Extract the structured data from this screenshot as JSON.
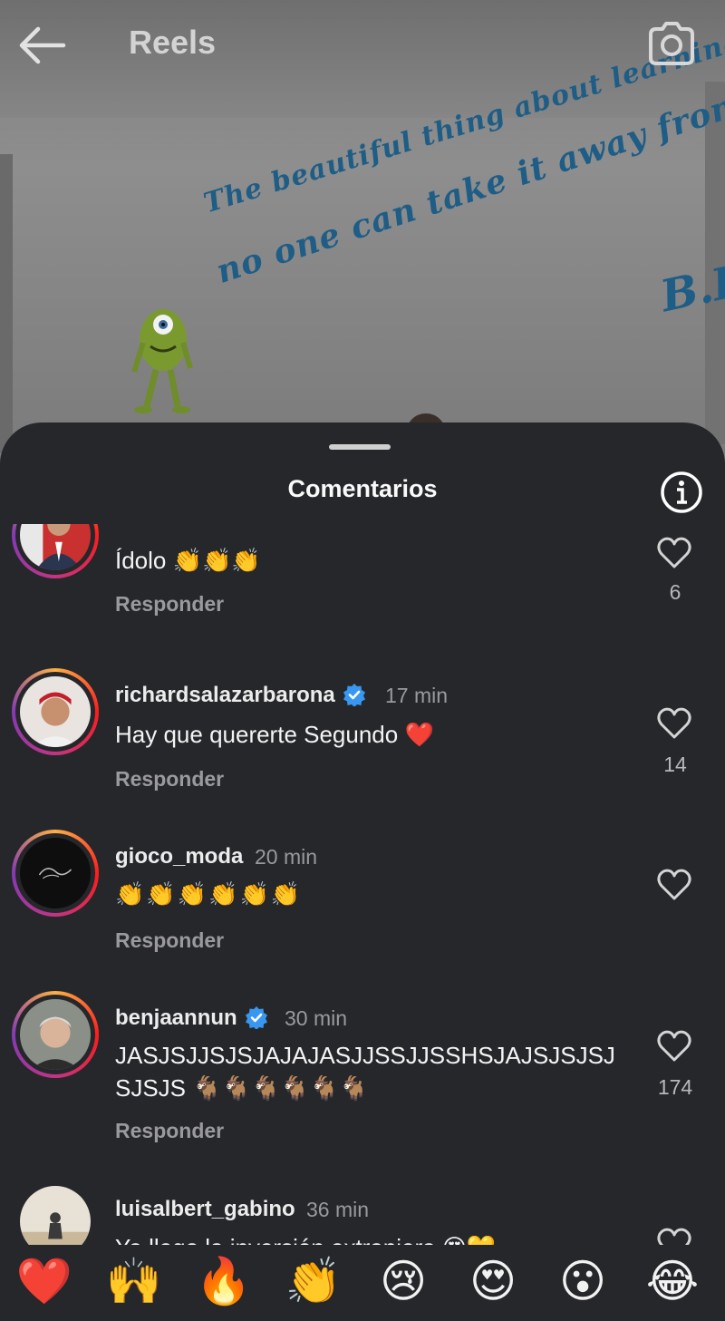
{
  "header": {
    "title": "Reels",
    "back_icon": "arrow-left-icon",
    "camera_icon": "camera-icon"
  },
  "video": {
    "quote_lines": [
      "The beautiful thing about learning i",
      "no one can take it away from yo",
      "B.B"
    ]
  },
  "sheet": {
    "title": "Comentarios",
    "info_icon": "info-icon"
  },
  "comments": [
    {
      "username": "",
      "verified": true,
      "time": "",
      "text": "Ídolo 👏👏👏",
      "reply_label": "Responder",
      "likes": "6"
    },
    {
      "username": "richardsalazarbarona",
      "verified": true,
      "time": "17 min",
      "text": "Hay que quererte Segundo ❤️",
      "reply_label": "Responder",
      "likes": "14"
    },
    {
      "username": "gioco_moda",
      "verified": false,
      "time": "20 min",
      "text": "👏👏👏👏👏👏",
      "reply_label": "Responder",
      "likes": ""
    },
    {
      "username": "benjaannun",
      "verified": true,
      "time": "30 min",
      "text": "JASJSJJSJSJAJAJASJJSSJJSSHSJAJSJSJSJSJSJS 🐐🐐🐐🐐🐐🐐",
      "reply_label": "Responder",
      "likes": "174"
    },
    {
      "username": "luisalbert_gabino",
      "verified": false,
      "time": "36 min",
      "text": "Ya llego la inversión extranjera 😍💛",
      "reply_label": "",
      "likes": ""
    }
  ],
  "reactions": [
    "❤️",
    "🙌",
    "🔥",
    "👏",
    "😢",
    "😍",
    "😮",
    "😂"
  ],
  "colors": {
    "sheet_bg": "#26272b",
    "verified_blue": "#3897f0",
    "quote_blue": "#1e5d86"
  }
}
